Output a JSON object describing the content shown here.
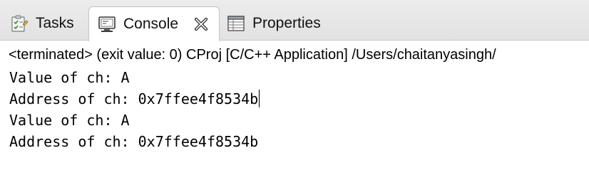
{
  "tabs": [
    {
      "label": "Tasks",
      "icon": "tasks-icon",
      "active": false
    },
    {
      "label": "Console",
      "icon": "console-icon",
      "active": true
    },
    {
      "label": "Properties",
      "icon": "properties-icon",
      "active": false
    }
  ],
  "console": {
    "status": "<terminated> (exit value: 0) CProj [C/C++ Application] /Users/chaitanyasingh/",
    "lines": [
      "Value of ch: A",
      "Address of ch: 0x7ffee4f8534b",
      "Value of ch: A",
      "Address of ch: 0x7ffee4f8534b"
    ]
  },
  "colors": {
    "tabbar_background": "#e6e6e6",
    "active_tab_background": "#ffffff",
    "text": "#000000"
  }
}
